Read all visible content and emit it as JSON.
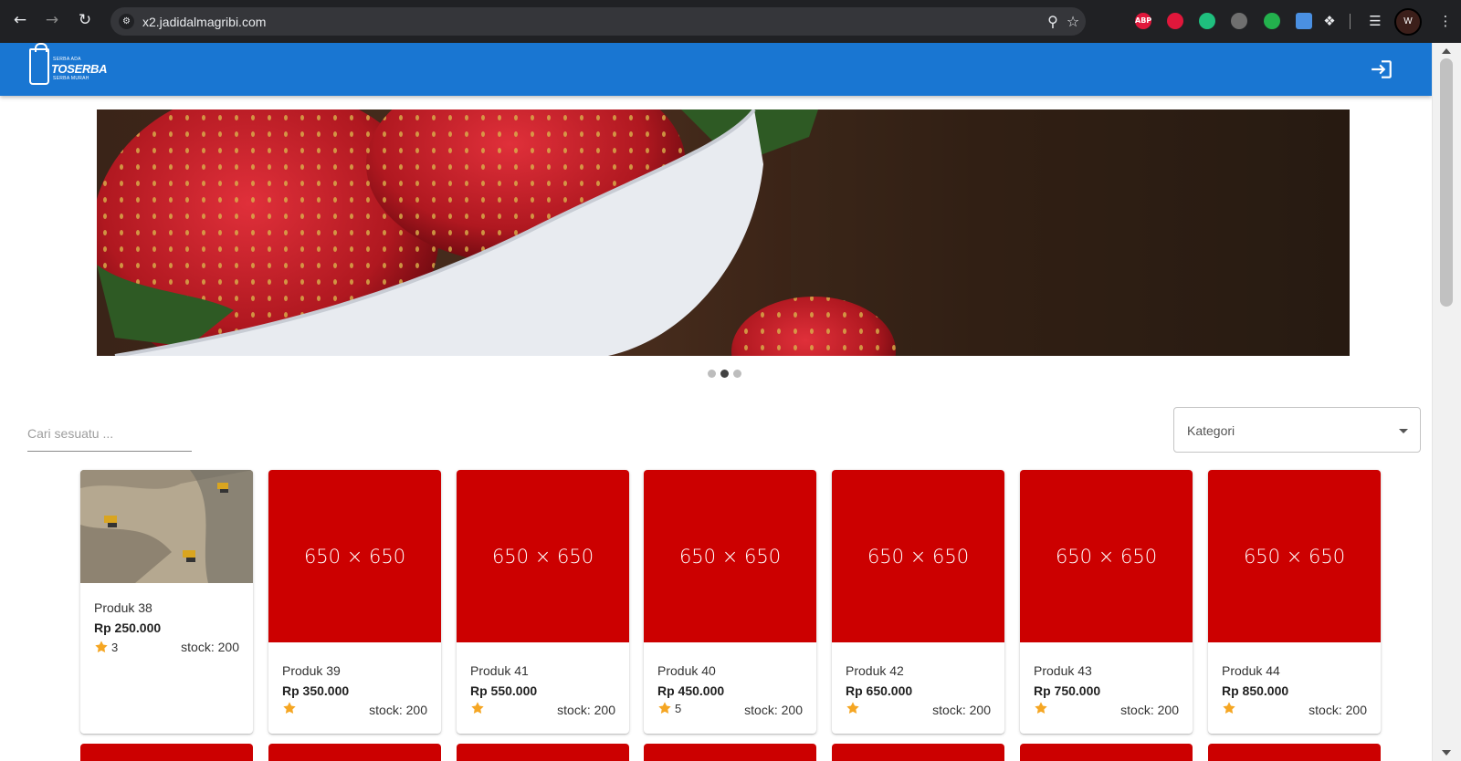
{
  "browser": {
    "url": "x2.jadidalmagribi.com",
    "profile_initial": "W",
    "extensions": [
      {
        "name": "adblock-plus-icon",
        "label": "ABP",
        "color": "#e0173b"
      },
      {
        "name": "hand-stop-icon",
        "label": "",
        "color": "#e0173b"
      },
      {
        "name": "target-icon",
        "label": "",
        "color": "#1fbf7e"
      },
      {
        "name": "flask-icon",
        "label": "",
        "color": "#6f6f6f"
      },
      {
        "name": "eye-icon",
        "label": "",
        "color": "#23b14d"
      },
      {
        "name": "docs-icon",
        "label": "",
        "color": "#4a90e2"
      }
    ]
  },
  "appbar": {
    "logo_top": "SERBA ADA",
    "logo_brand": "TOSERBA",
    "logo_bottom": "SERBA MURAH",
    "color": "#1976d2"
  },
  "carousel": {
    "slide_count": 3,
    "active_index": 1
  },
  "search": {
    "placeholder": "Cari sesuatu ..."
  },
  "kategori": {
    "label": "Kategori"
  },
  "products": [
    {
      "name": "Produk 38",
      "price": "Rp 250.000",
      "rating": "3",
      "stock": "stock: 200",
      "image": "photo"
    },
    {
      "name": "Produk 39",
      "price": "Rp 350.000",
      "rating": "",
      "stock": "stock: 200",
      "image": "650 × 650"
    },
    {
      "name": "Produk 41",
      "price": "Rp 550.000",
      "rating": "",
      "stock": "stock: 200",
      "image": "650 × 650"
    },
    {
      "name": "Produk 40",
      "price": "Rp 450.000",
      "rating": "5",
      "stock": "stock: 200",
      "image": "650 × 650"
    },
    {
      "name": "Produk 42",
      "price": "Rp 650.000",
      "rating": "",
      "stock": "stock: 200",
      "image": "650 × 650"
    },
    {
      "name": "Produk 43",
      "price": "Rp 750.000",
      "rating": "",
      "stock": "stock: 200",
      "image": "650 × 650"
    },
    {
      "name": "Produk 44",
      "price": "Rp 850.000",
      "rating": "",
      "stock": "stock: 200",
      "image": "650 × 650"
    }
  ],
  "colors": {
    "placeholder_red": "#cc0000",
    "star": "#f5a623"
  }
}
